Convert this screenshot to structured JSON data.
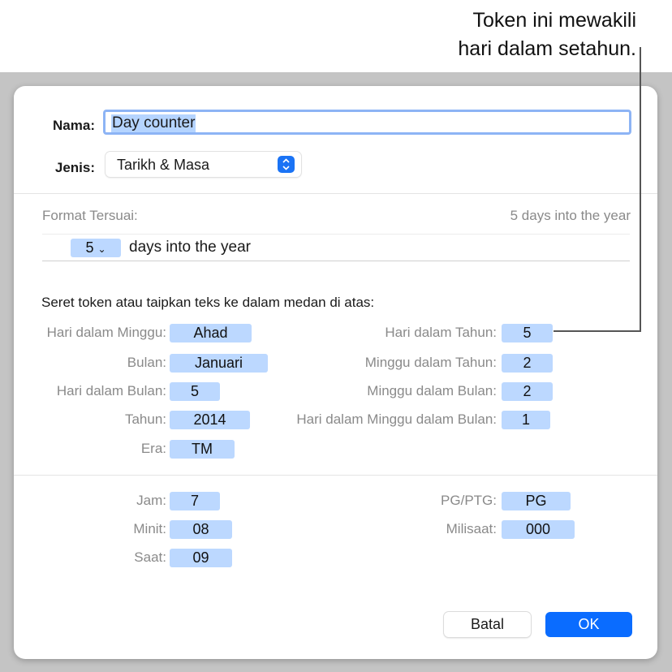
{
  "callout": {
    "line1": "Token ini mewakili",
    "line2": "hari dalam setahun."
  },
  "dialog": {
    "name_label": "Nama:",
    "name_value": "Day counter",
    "type_label": "Jenis:",
    "type_value": "Tarikh & Masa",
    "type_stepper_icon": "⌃⌄",
    "custom_format_label": "Format Tersuai:",
    "custom_format_preview": "5 days into the year",
    "format_token_value": "5",
    "format_token_chevron": "⌄",
    "format_text": "days into the year",
    "instructions": "Seret token atau taipkan teks ke dalam medan di atas:",
    "date_tokens_left": [
      {
        "label": "Hari dalam Minggu:",
        "value": "Ahad"
      },
      {
        "label": "Bulan:",
        "value": "Januari"
      },
      {
        "label": "Hari dalam Bulan:",
        "value": "5"
      },
      {
        "label": "Tahun:",
        "value": "2014"
      },
      {
        "label": "Era:",
        "value": "TM"
      }
    ],
    "date_tokens_right": [
      {
        "label": "Hari dalam Tahun:",
        "value": "5"
      },
      {
        "label": "Minggu dalam Tahun:",
        "value": "2"
      },
      {
        "label": "Minggu dalam Bulan:",
        "value": "2"
      },
      {
        "label": "Hari dalam Minggu dalam Bulan:",
        "value": "1"
      }
    ],
    "time_tokens_left": [
      {
        "label": "Jam:",
        "value": "7"
      },
      {
        "label": "Minit:",
        "value": "08"
      },
      {
        "label": "Saat:",
        "value": "09"
      }
    ],
    "time_tokens_right": [
      {
        "label": "PG/PTG:",
        "value": "PG"
      },
      {
        "label": "Milisaat:",
        "value": "000"
      }
    ],
    "cancel_label": "Batal",
    "ok_label": "OK"
  },
  "colors": {
    "token_bg": "#bcd8ff",
    "accent": "#0a6cff"
  }
}
